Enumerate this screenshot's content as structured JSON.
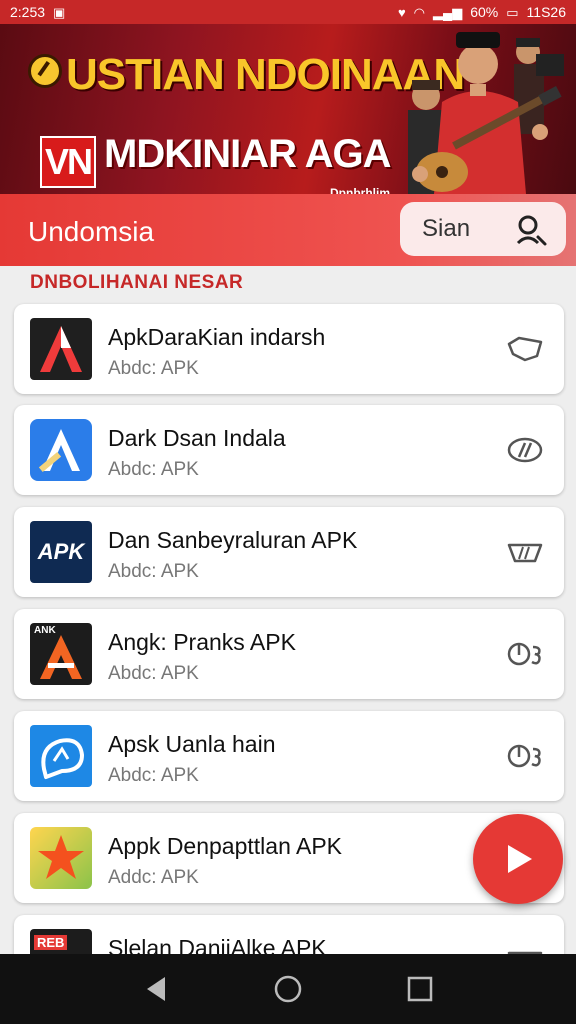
{
  "status_bar": {
    "time": "2:253",
    "battery": "60%",
    "clock": "11S26"
  },
  "banner": {
    "title": "USTIAN NDOINAAN",
    "badge": "VN",
    "subtitle": "MDKINIAR AGA",
    "caption": "Dpnbrhlim"
  },
  "search": {
    "title": "Undomsia",
    "button_label": "Sian"
  },
  "section_label": "DNBOLIHANAI NESAR",
  "apps": [
    {
      "name": "ApkDaraKian indarsh",
      "sub": "Abdc: APK",
      "action": "heart"
    },
    {
      "name": "Dark Dsan Indala",
      "sub": "Abdc: APK",
      "action": "link"
    },
    {
      "name": "Dan Sanbeyraluran APK",
      "sub": "Abdc: APK",
      "action": "heart"
    },
    {
      "name": "Angk: Pranks APK",
      "sub": "Abdc: APK",
      "action": "timer"
    },
    {
      "name": "Apsk Uanla hain",
      "sub": "Abdc: APK",
      "action": "timer"
    },
    {
      "name": "Appk Denpapttlan APK",
      "sub": "Addc: APK",
      "action": "none"
    },
    {
      "name": "Slelan DaniiAlke APK",
      "sub": "",
      "action": "heart"
    }
  ],
  "icon_text": {
    "apk_tile": "APK",
    "pranks_badge": "ANK",
    "last_badge": "REB"
  },
  "colors": {
    "primary": "#e53935",
    "status_bar": "#c62828",
    "accent_yellow": "#f9c62a"
  }
}
